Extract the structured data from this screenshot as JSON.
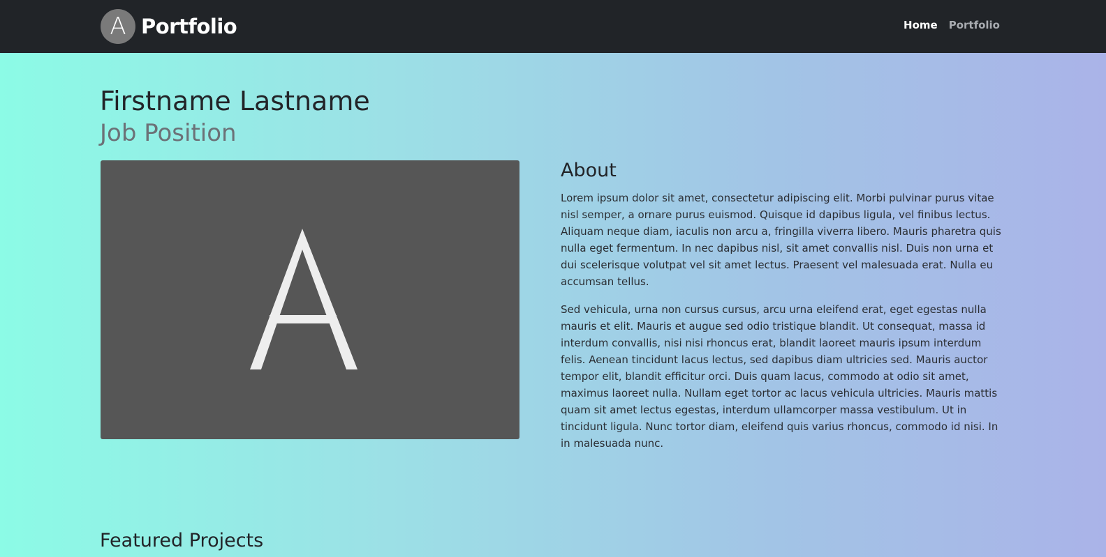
{
  "navbar": {
    "brand_logo_letter": "A",
    "brand_name": "Portfolio",
    "links": [
      {
        "label": "Home",
        "active": true
      },
      {
        "label": "Portfolio",
        "active": false
      }
    ]
  },
  "hero": {
    "name": "Firstname Lastname",
    "job": "Job Position"
  },
  "photo": {
    "placeholder_letter": "A"
  },
  "about": {
    "title": "About",
    "paragraphs": [
      "Lorem ipsum dolor sit amet, consectetur adipiscing elit. Morbi pulvinar purus vitae nisl semper, a ornare purus euismod. Quisque id dapibus ligula, vel finibus lectus. Aliquam neque diam, iaculis non arcu a, fringilla viverra libero. Mauris pharetra quis nulla eget fermentum. In nec dapibus nisl, sit amet convallis nisl. Duis non urna et dui scelerisque volutpat vel sit amet lectus. Praesent vel malesuada erat. Nulla eu accumsan tellus.",
      "Sed vehicula, urna non cursus cursus, arcu urna eleifend erat, eget egestas nulla mauris et elit. Mauris et augue sed odio tristique blandit. Ut consequat, massa id interdum convallis, nisi nisi rhoncus erat, blandit laoreet mauris ipsum interdum felis. Aenean tincidunt lacus lectus, sed dapibus diam ultricies sed. Mauris auctor tempor elit, blandit efficitur orci. Duis quam lacus, commodo at odio sit amet, maximus laoreet nulla. Nullam eget tortor ac lacus vehicula ultricies. Mauris mattis quam sit amet lectus egestas, interdum ullamcorper massa vestibulum. Ut in tincidunt ligula. Nunc tortor diam, eleifend quis varius rhoncus, commodo id nisi. In in malesuada nunc."
    ]
  },
  "featured": {
    "title": "Featured Projects"
  },
  "colors": {
    "navbar_bg": "#212428",
    "gradient_start": "#8cfbe6",
    "gradient_end": "#aab3e8",
    "photo_bg": "#565656",
    "job_text": "#6c7177"
  }
}
